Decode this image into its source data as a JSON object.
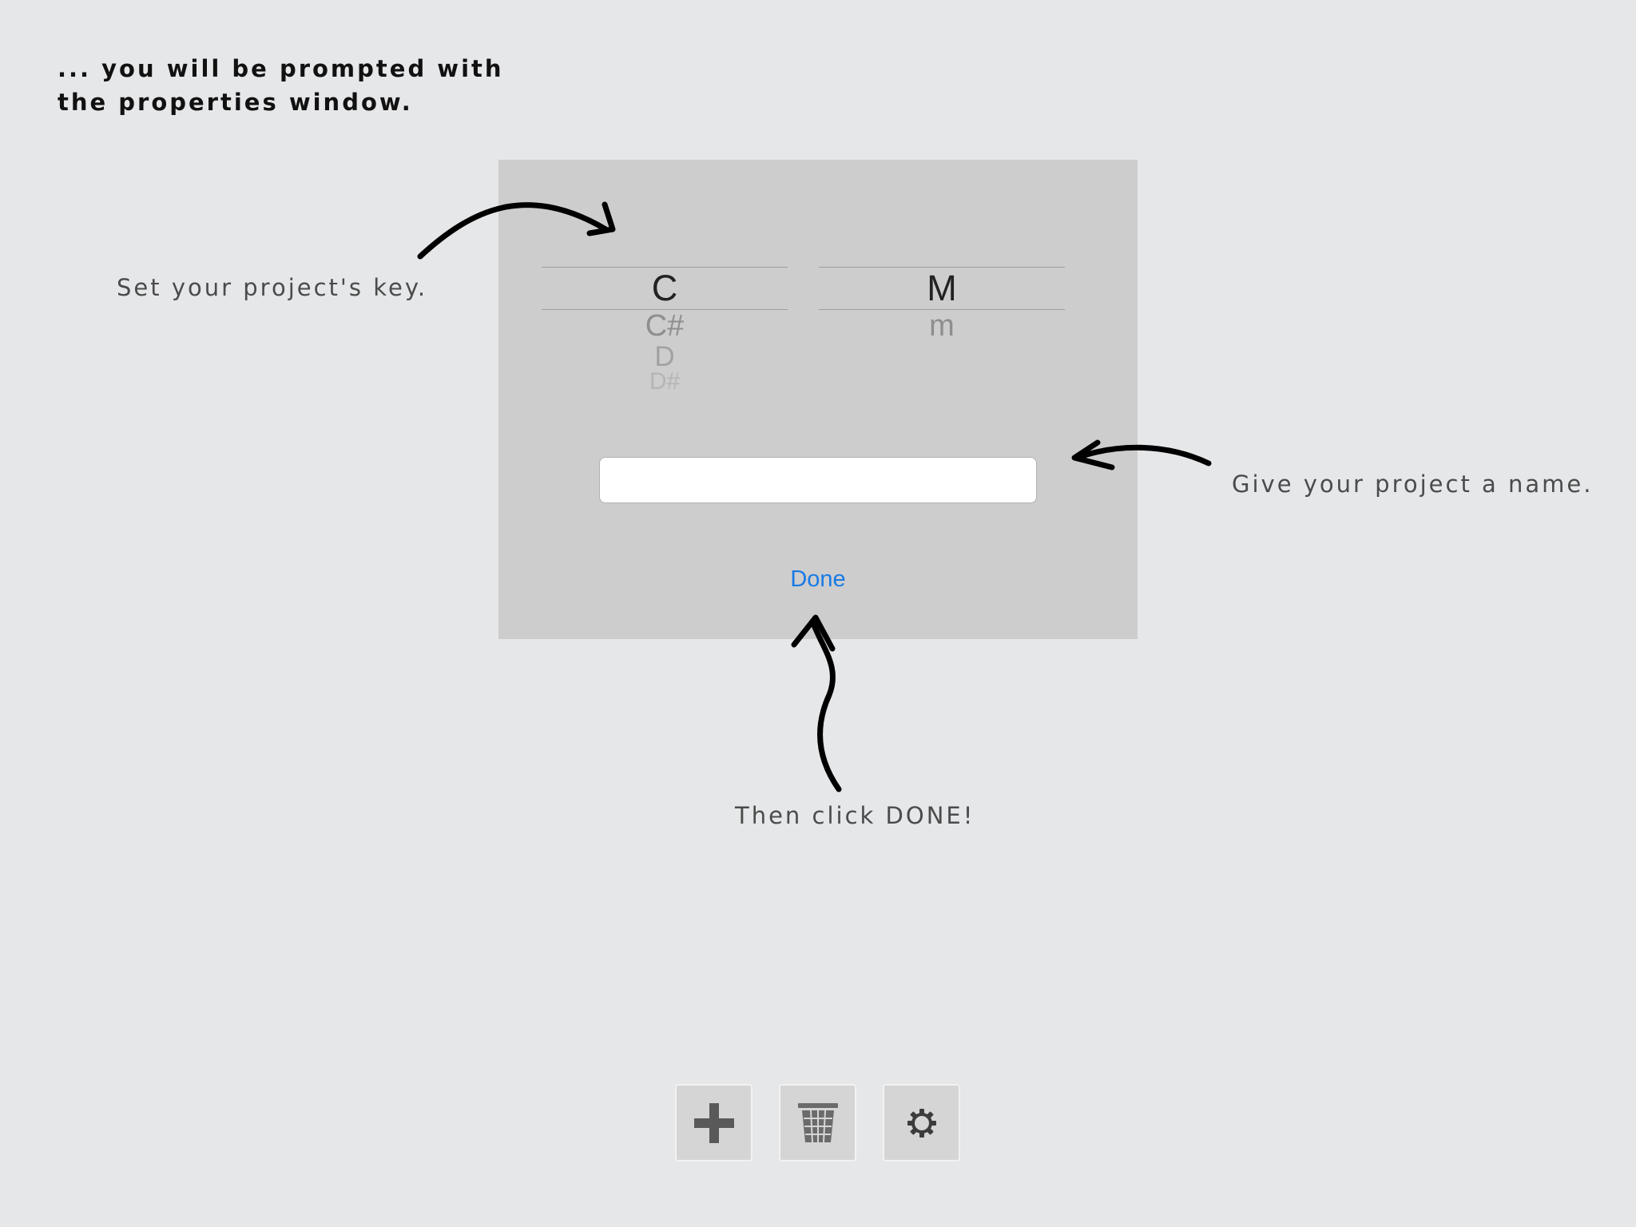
{
  "annotations": {
    "intro": [
      "... you will be prompted with",
      "the properties window."
    ],
    "set_key": "Set your project's key.",
    "name": "Give your project a name.",
    "done": "Then click DONE!"
  },
  "dialog": {
    "key_picker": {
      "selected": "C",
      "following": [
        "C#",
        "D",
        "D#"
      ]
    },
    "mode_picker": {
      "selected": "M",
      "following": [
        "m"
      ]
    },
    "name_field": {
      "value": "",
      "placeholder": ""
    },
    "done_label": "Done",
    "done_color": "#1a7ae6"
  },
  "toolbar": {
    "buttons": [
      {
        "icon": "plus-icon"
      },
      {
        "icon": "trash-icon"
      },
      {
        "icon": "gear-icon"
      }
    ]
  }
}
